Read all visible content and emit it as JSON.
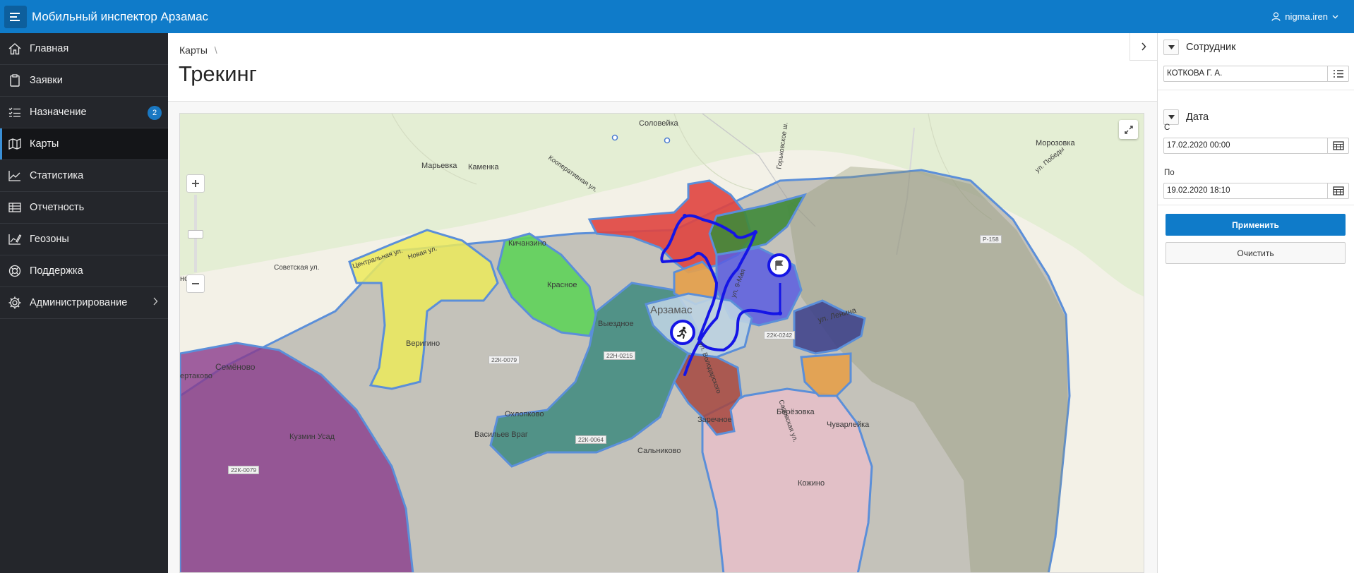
{
  "header": {
    "app_title": "Мобильный инспектор Арзамас",
    "user_name": "nigma.iren"
  },
  "sidebar": {
    "items": [
      {
        "label": "Главная",
        "icon": "home-icon"
      },
      {
        "label": "Заявки",
        "icon": "clipboard-icon"
      },
      {
        "label": "Назначение",
        "icon": "checklist-icon",
        "badge": "2"
      },
      {
        "label": "Карты",
        "icon": "map-icon",
        "active": true
      },
      {
        "label": "Статистика",
        "icon": "line-chart-icon"
      },
      {
        "label": "Отчетность",
        "icon": "table-icon"
      },
      {
        "label": "Геозоны",
        "icon": "edit-chart-icon"
      },
      {
        "label": "Поддержка",
        "icon": "lifebuoy-icon"
      },
      {
        "label": "Администрирование",
        "icon": "gear-icon"
      }
    ]
  },
  "page": {
    "breadcrumb": "Карты",
    "breadcrumb_sep": "\\",
    "title": "Трекинг"
  },
  "map": {
    "labels": {
      "solovieyka": "Соловейка",
      "maryevka": "Марьевка",
      "kamenka": "Каменка",
      "kooperativnaya": "Кооперативная ул.",
      "gorkovskoe": "Горьковское ш.",
      "morozovka": "Морозовка",
      "pobedy": "ул. Победы",
      "p158": "Р-158",
      "kichanzino": "Кичанзино",
      "krasnoe": "Красное",
      "sovetskaya": "Советская ул.",
      "centralnaya": "Центральная ул.",
      "novaya": "Новая ул.",
      "novo": "ново",
      "arzamas": "Арзамас",
      "vyezdnoe": "Выездное",
      "verigino": "Веригино",
      "semenovo": "Семёново",
      "ertakovo": "ертаково",
      "kuzmin": "Кузмин Усад",
      "okhlopkovo": "Охлопково",
      "vasilyev": "Васильев Враг",
      "salnikovo": "Сальниково",
      "zarechnoe": "Заречное",
      "berezovka": "Берёзовка",
      "chuvarleyka": "Чуварлейка",
      "kozhino": "Кожино",
      "lenina": "ул. Ленина",
      "maya": "ул. 9-Мая",
      "volodarskogo": "ул. Володарского",
      "sarovskaya": "Саровская ул.",
      "r22k0242": "22К-0242",
      "r22k0079a": "22К-0079",
      "r22k0079b": "22К-0079",
      "r22n0215": "22Н-0215",
      "r22k0064": "22К-0064"
    }
  },
  "filters": {
    "employee_header": "Сотрудник",
    "employee_value": "КОТКОВА Г. А.",
    "date_header": "Дата",
    "from_label": "С",
    "from_value": "17.02.2020 00:00",
    "to_label": "По",
    "to_value": "19.02.2020 18:10",
    "apply_label": "Применить",
    "clear_label": "Очистить"
  }
}
